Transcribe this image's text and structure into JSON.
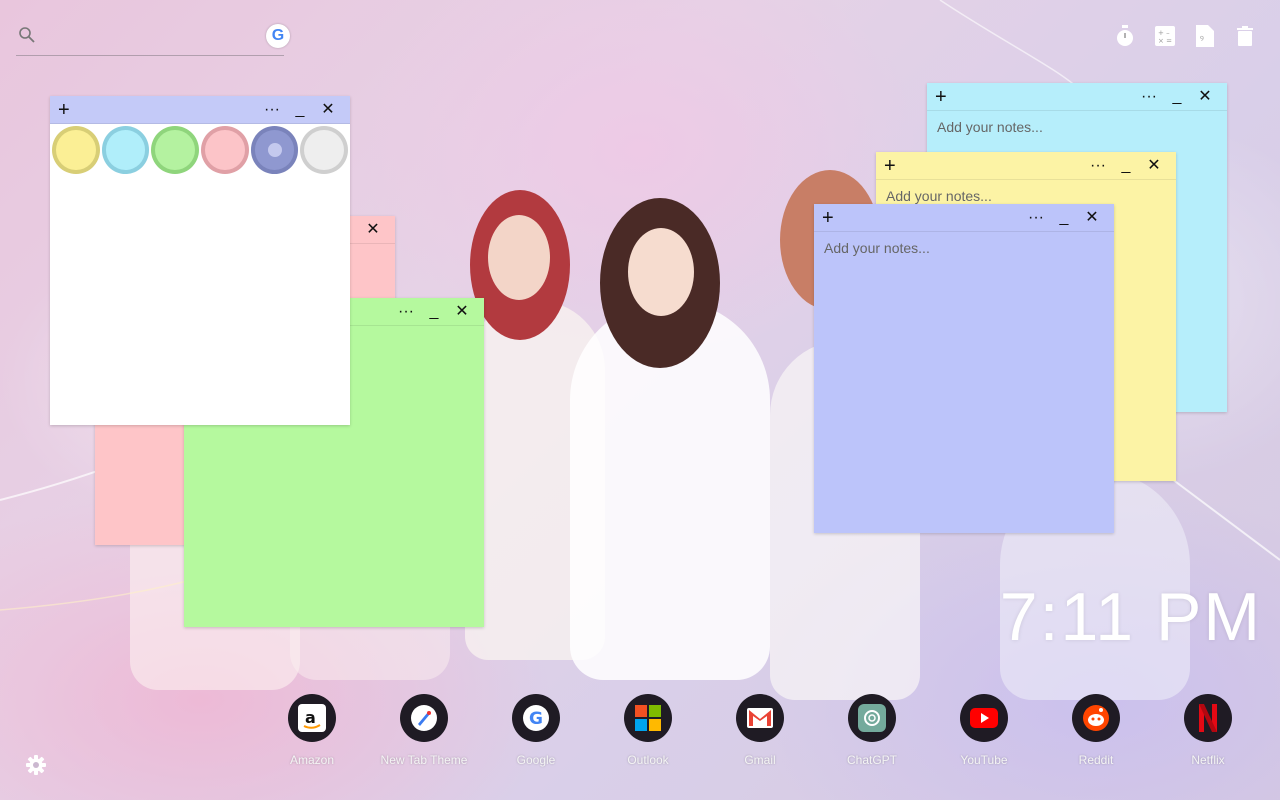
{
  "search": {
    "placeholder": "",
    "google_glyph": "G"
  },
  "tools": [
    {
      "name": "stopwatch-icon"
    },
    {
      "name": "calculator-icon"
    },
    {
      "name": "document-icon"
    },
    {
      "name": "trash-icon"
    }
  ],
  "notes": {
    "white": {
      "plus": "+",
      "more": "···",
      "minimize": "_",
      "close": "✕"
    },
    "pink": {
      "minimize": "_",
      "close": "✕"
    },
    "green": {
      "more": "···",
      "minimize": "_",
      "close": "✕"
    },
    "cyan": {
      "plus": "+",
      "more": "···",
      "minimize": "_",
      "close": "✕",
      "placeholder": "Add your notes..."
    },
    "yellow": {
      "plus": "+",
      "more": "···",
      "minimize": "_",
      "close": "✕",
      "placeholder": "Add your notes..."
    },
    "blue": {
      "plus": "+",
      "more": "···",
      "minimize": "_",
      "close": "✕",
      "placeholder": "Add your notes..."
    }
  },
  "swatch_colors": [
    {
      "fill": "#fbef95",
      "ring": "#d8ce76"
    },
    {
      "fill": "#b0eefa",
      "ring": "#8bcfe0"
    },
    {
      "fill": "#b4f2a0",
      "ring": "#8fd57c"
    },
    {
      "fill": "#fcc4c8",
      "ring": "#e0a0a6"
    },
    {
      "fill": "#8f98d0",
      "ring": "#7a83bb"
    },
    {
      "fill": "#eeeeee",
      "ring": "#cfcfcf"
    }
  ],
  "note_colors": {
    "white": "#ffffff",
    "white_bar": "#c4caf8",
    "pink": "#fec5c8",
    "green": "#b5f99e",
    "cyan": "#b6eefb",
    "yellow": "#fcf3a5",
    "blue": "#bcc4fa"
  },
  "clock": {
    "time": "7:11 PM"
  },
  "dock": [
    {
      "label": "Amazon",
      "icon": "amazon-icon"
    },
    {
      "label": "New Tab Theme",
      "icon": "compass-icon"
    },
    {
      "label": "Google",
      "icon": "google-icon"
    },
    {
      "label": "Outlook",
      "icon": "windows-icon"
    },
    {
      "label": "Gmail",
      "icon": "gmail-icon"
    },
    {
      "label": "ChatGPT",
      "icon": "chatgpt-icon"
    },
    {
      "label": "YouTube",
      "icon": "youtube-icon"
    },
    {
      "label": "Reddit",
      "icon": "reddit-icon"
    },
    {
      "label": "Netflix",
      "icon": "netflix-icon"
    }
  ]
}
